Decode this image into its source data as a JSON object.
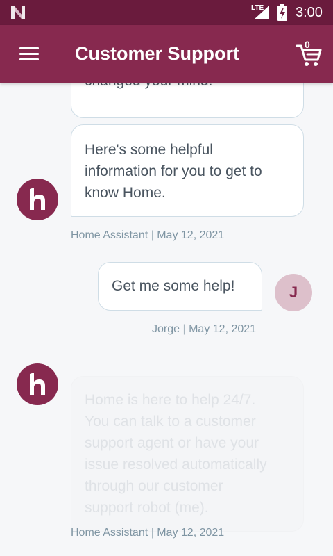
{
  "status_bar": {
    "network": "LTE",
    "time": "3:00"
  },
  "app_bar": {
    "title": "Customer Support",
    "cart_count": "0",
    "menu_icon": "hamburger-menu-icon",
    "cart_icon": "shopping-cart-icon"
  },
  "colors": {
    "status_bar": "#6a1b3d",
    "app_bar": "#87294f",
    "bot_avatar": "#87294f",
    "user_avatar": "#ddc0cb",
    "meta_text": "#7f95a3"
  },
  "messages": [
    {
      "sender": "bot",
      "lines": [
        "changed your mind."
      ]
    },
    {
      "sender": "bot",
      "lines": [
        "Here's some helpful",
        "information for you to get to",
        "know Home."
      ],
      "author": "Home Assistant",
      "date": "May 12, 2021"
    },
    {
      "sender": "user",
      "avatar_letter": "J",
      "lines": [
        "Get me some help!"
      ],
      "author": "Jorge",
      "date": "May 12, 2021"
    },
    {
      "sender": "bot",
      "lines": [
        "Home is here to help 24/7.",
        "You can talk to a customer",
        "support agent or have your",
        "issue resolved automatically",
        "through our customer",
        "support robot (me)."
      ],
      "author": "Home Assistant",
      "date": "May 12, 2021"
    }
  ],
  "separator": "|"
}
